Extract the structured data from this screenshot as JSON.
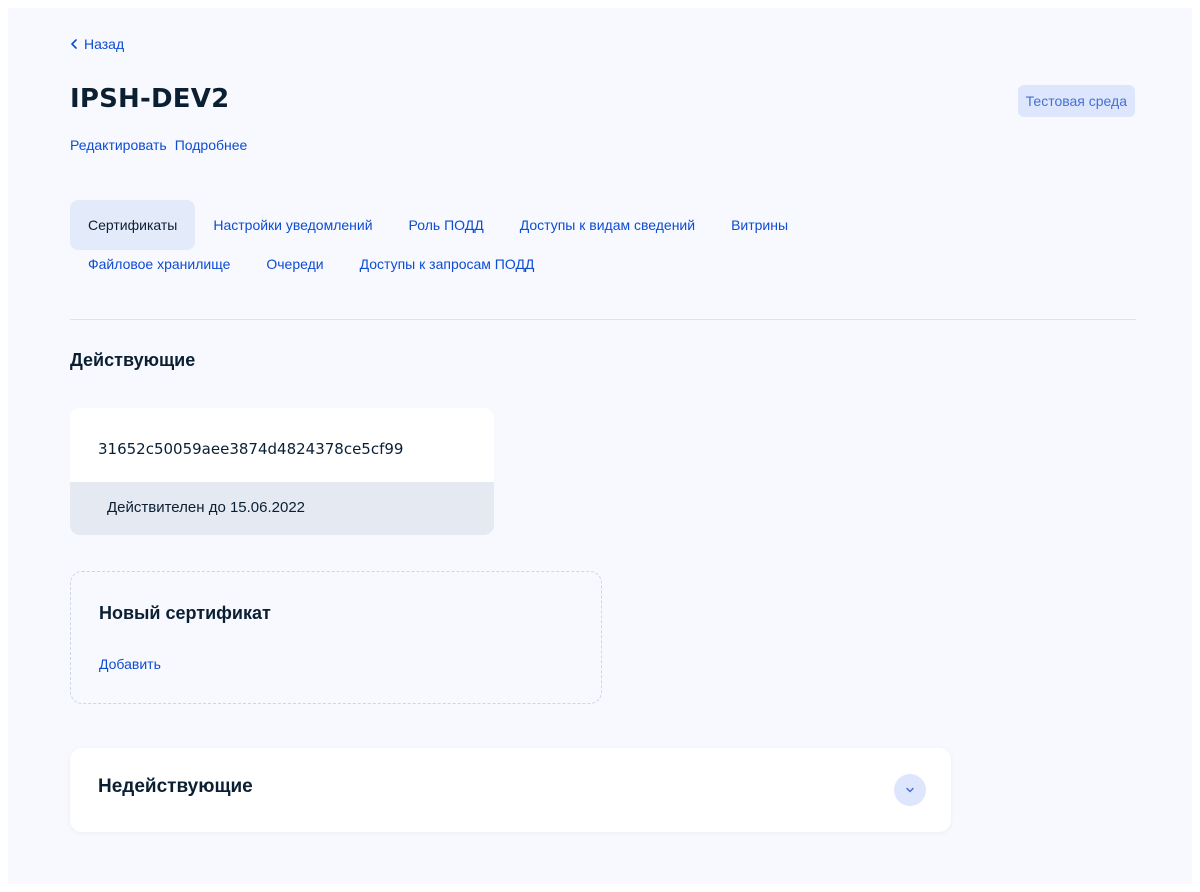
{
  "header": {
    "back_label": "Назад",
    "title": "IPSH-DEV2",
    "edit_link": "Редактировать",
    "details_link": "Подробнее",
    "env_badge": "Тестовая среда"
  },
  "tabs": [
    {
      "label": "Сертификаты",
      "active": true
    },
    {
      "label": "Настройки уведомлений"
    },
    {
      "label": "Роль ПОДД"
    },
    {
      "label": "Доступы к видам сведений"
    },
    {
      "label": "Витрины"
    },
    {
      "label": "Файловое хранилище"
    },
    {
      "label": "Очереди"
    },
    {
      "label": "Доступы к запросам ПОДД"
    }
  ],
  "active_section": {
    "title": "Действующие",
    "certificate": {
      "id": "31652c50059aee3874d4824378ce5cf99",
      "valid_until": "Действителен до 15.06.2022"
    }
  },
  "new_certificate": {
    "title": "Новый сертификат",
    "add_link": "Добавить"
  },
  "inactive_section": {
    "title": "Недействующие",
    "toggle_icon": "chevron-down-icon"
  },
  "colors": {
    "link": "#0d4cd3",
    "page_bg": "#f8f9fe",
    "badge_bg": "#dde6fc",
    "active_tab_bg": "#e3ebfa",
    "cert_footer_bg": "#e4e9f2"
  }
}
